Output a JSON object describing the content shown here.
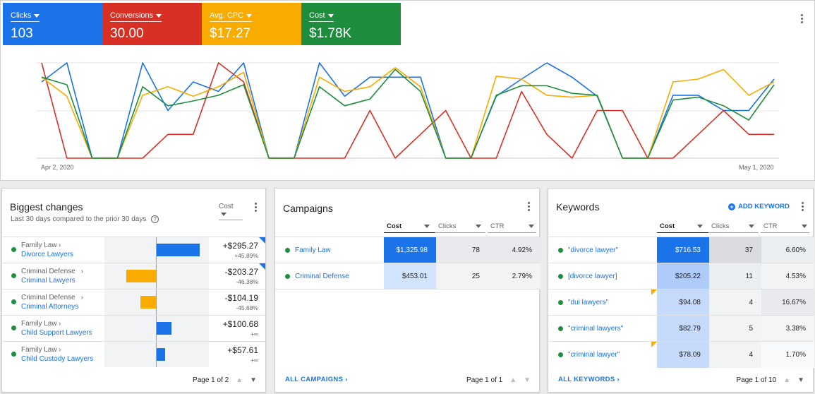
{
  "metrics": [
    {
      "label": "Clicks",
      "value": "103",
      "color": "#1a73e8"
    },
    {
      "label": "Conversions",
      "value": "30.00",
      "color": "#d93025"
    },
    {
      "label": "Avg. CPC",
      "value": "$17.27",
      "color": "#f9ab00"
    },
    {
      "label": "Cost",
      "value": "$1.78K",
      "color": "#1e8e3e"
    }
  ],
  "chart_data": {
    "type": "line",
    "x_start_label": "Apr 2, 2020",
    "x_end_label": "May 1, 2020",
    "grid": true,
    "series": [
      {
        "color": "#1a73e8",
        "values": [
          0.8,
          1.0,
          0.0,
          0.0,
          1.0,
          0.5,
          0.8,
          0.7,
          1.0,
          0.0,
          0.0,
          1.0,
          0.65,
          0.85,
          0.85,
          0.85,
          0.0,
          0.0,
          0.65,
          0.83,
          1.0,
          0.85,
          0.65,
          0.0,
          0.0,
          0.66,
          0.66,
          0.5,
          0.5,
          0.83
        ]
      },
      {
        "color": "#d93025",
        "values": [
          1.0,
          0.0,
          0.0,
          0.0,
          0.0,
          0.25,
          0.25,
          1.0,
          0.8,
          0.0,
          0.0,
          0.0,
          0.0,
          0.5,
          0.0,
          0.25,
          0.5,
          0.0,
          0.0,
          0.7,
          0.25,
          0.0,
          0.5,
          0.5,
          0.0,
          0.0,
          0.25,
          0.5,
          0.25,
          0.25
        ]
      },
      {
        "color": "#f9ab00",
        "values": [
          0.85,
          0.65,
          0.0,
          0.0,
          0.66,
          0.75,
          0.65,
          0.75,
          0.9,
          0.0,
          0.0,
          0.85,
          0.7,
          0.75,
          0.95,
          0.75,
          0.0,
          0.0,
          0.86,
          0.83,
          0.66,
          0.64,
          0.66,
          0.0,
          0.0,
          0.8,
          0.83,
          0.93,
          0.66,
          0.8
        ]
      },
      {
        "color": "#1e8e3e",
        "values": [
          0.85,
          0.77,
          0.0,
          0.0,
          0.75,
          0.55,
          0.6,
          0.66,
          0.77,
          0.0,
          0.0,
          0.75,
          0.55,
          0.62,
          0.93,
          0.7,
          0.0,
          0.0,
          0.66,
          0.76,
          0.76,
          0.68,
          0.66,
          0.0,
          0.0,
          0.61,
          0.64,
          0.55,
          0.4,
          0.77
        ]
      }
    ]
  },
  "biggest_changes": {
    "title": "Biggest changes",
    "subtitle": "Last 30 days compared to the prior 30 days",
    "metric_select": "Cost",
    "rows": [
      {
        "campaign": "Family Law",
        "name": "Divorce Lawyers",
        "value": "+$295.27",
        "change": "+45.89%",
        "bar": 295.27,
        "flag": true
      },
      {
        "campaign": "Criminal Defense",
        "name": "Criminal Lawyers",
        "value": "-$203.27",
        "change": "-46.38%",
        "bar": -203.27,
        "flag": true
      },
      {
        "campaign": "Criminal Defense",
        "name": "Criminal Attorneys",
        "value": "-$104.19",
        "change": "-45.68%",
        "bar": -104.19,
        "flag": false
      },
      {
        "campaign": "Family Law",
        "name": "Child Support Lawyers",
        "value": "+$100.68",
        "change": "+∞",
        "bar": 100.68,
        "flag": false
      },
      {
        "campaign": "Family Law",
        "name": "Child Custody Lawyers",
        "value": "+$57.61",
        "change": "+∞",
        "bar": 57.61,
        "flag": false
      }
    ],
    "page": "Page 1 of 2"
  },
  "campaigns": {
    "title": "Campaigns",
    "columns": [
      "Cost",
      "Clicks",
      "CTR"
    ],
    "rows": [
      {
        "name": "Family Law",
        "cost": "$1,325.98",
        "clicks": "78",
        "ctr": "4.92%"
      },
      {
        "name": "Criminal Defense",
        "cost": "$453.01",
        "clicks": "25",
        "ctr": "2.79%"
      }
    ],
    "footer_link": "ALL CAMPAIGNS",
    "page": "Page 1 of 1"
  },
  "keywords": {
    "title": "Keywords",
    "add_label": "ADD KEYWORD",
    "columns": [
      "Cost",
      "Clicks",
      "CTR"
    ],
    "rows": [
      {
        "name": "\"divorce lawyer\"",
        "cost": "$716.53",
        "clicks": "37",
        "ctr": "6.60%",
        "flag": false
      },
      {
        "name": "[divorce lawyer]",
        "cost": "$205.22",
        "clicks": "11",
        "ctr": "4.53%",
        "flag": false
      },
      {
        "name": "\"dui lawyers\"",
        "cost": "$94.08",
        "clicks": "4",
        "ctr": "16.67%",
        "flag": true
      },
      {
        "name": "\"criminal lawyers\"",
        "cost": "$82.79",
        "clicks": "5",
        "ctr": "3.38%",
        "flag": false
      },
      {
        "name": "\"criminal lawyer\"",
        "cost": "$78.09",
        "clicks": "4",
        "ctr": "1.70%",
        "flag": true
      }
    ],
    "footer_link": "ALL KEYWORDS",
    "page": "Page 1 of 10"
  }
}
